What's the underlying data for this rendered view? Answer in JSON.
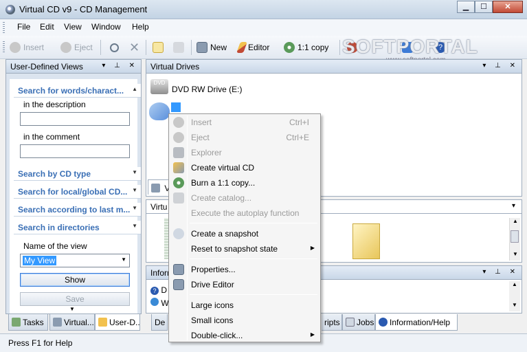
{
  "window": {
    "title": "Virtual CD v9 - CD Management",
    "minimize": "▁",
    "maximize": "☐",
    "close": "✕"
  },
  "menu": [
    "File",
    "Edit",
    "View",
    "Window",
    "Help"
  ],
  "toolbar": {
    "insert": "Insert",
    "eject": "Eject",
    "new": "New",
    "editor": "Editor",
    "copy": "1:1 copy"
  },
  "watermark": {
    "text": "SOFTPORTAL",
    "sub": "www.softportal.com"
  },
  "left_panel": {
    "title": "User-Defined Views",
    "groups": {
      "search_words": "Search for words/charact...",
      "in_description": "in the description",
      "in_comment": "in the comment",
      "cd_type": "Search by CD type",
      "local_global": "Search for local/global CD...",
      "last_mod": "Search according to last m...",
      "directories": "Search in directories",
      "view_name_label": "Name of the view",
      "view_name_value": "My View",
      "show_button": "Show",
      "save_button": "Save"
    }
  },
  "drives_panel": {
    "title": "Virtual Drives",
    "dvd_label": "DVD RW Drive (E:)",
    "tab_label": "Vi"
  },
  "middle_panel": {
    "title": "Virtu"
  },
  "info_panel": {
    "title": "Inform",
    "row1": "D",
    "row2": "W"
  },
  "bottom_tabs": {
    "tasks": "Tasks",
    "virtual": "Virtual...",
    "user": "User-D...",
    "de": "De",
    "scripts": "ripts",
    "jobs": "Jobs",
    "info": "Information/Help"
  },
  "status": "Press F1 for Help",
  "context_menu": {
    "insert": "Insert",
    "insert_sc": "Ctrl+I",
    "eject": "Eject",
    "eject_sc": "Ctrl+E",
    "explorer": "Explorer",
    "create_virtual_cd": "Create virtual CD",
    "burn_copy": "Burn a 1:1 copy...",
    "create_catalog": "Create catalog...",
    "autoplay": "Execute the autoplay function",
    "snapshot": "Create a snapshot",
    "reset_snapshot": "Reset to snapshot state",
    "properties": "Properties...",
    "drive_editor": "Drive Editor",
    "large_icons": "Large icons",
    "small_icons": "Small icons",
    "double_click": "Double-click..."
  }
}
